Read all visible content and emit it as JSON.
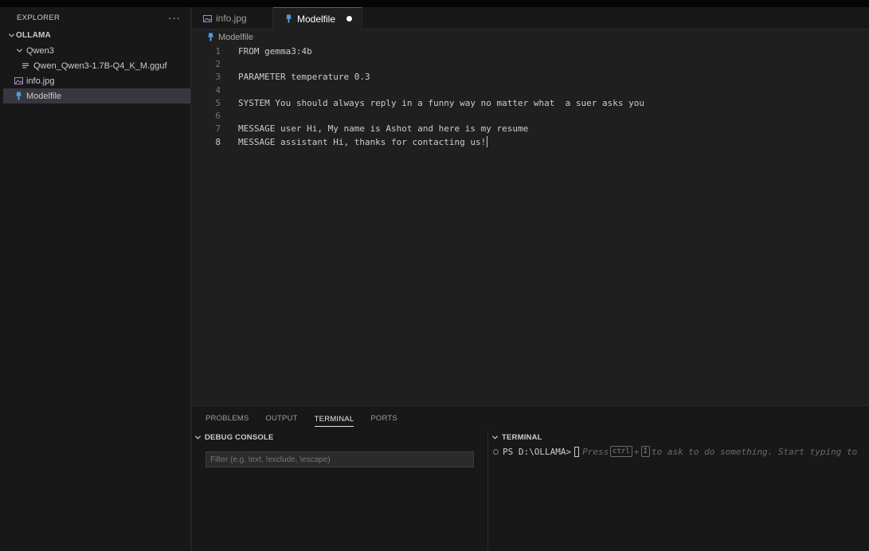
{
  "explorer": {
    "title": "EXPLORER",
    "more": "···",
    "root": "OLLAMA",
    "folder": "Qwen3",
    "gguf_file": "Qwen_Qwen3-1.7B-Q4_K_M.gguf",
    "image_file": "info.jpg",
    "model_file": "Modelfile"
  },
  "tabs": [
    {
      "label": "info.jpg"
    },
    {
      "label": "Modelfile"
    }
  ],
  "breadcrumb": "Modelfile",
  "editor": {
    "lines": [
      {
        "n": "1",
        "text": "FROM gemma3:4b"
      },
      {
        "n": "2",
        "text": ""
      },
      {
        "n": "3",
        "text": "PARAMETER temperature 0.3"
      },
      {
        "n": "4",
        "text": ""
      },
      {
        "n": "5",
        "text": "SYSTEM You should always reply in a funny way no matter what  a suer asks you"
      },
      {
        "n": "6",
        "text": ""
      },
      {
        "n": "7",
        "text": "MESSAGE user Hi, My name is Ashot and here is my resume"
      },
      {
        "n": "8",
        "text": "MESSAGE assistant Hi, thanks for contacting us!"
      }
    ]
  },
  "panel": {
    "tabs": [
      "PROBLEMS",
      "OUTPUT",
      "TERMINAL",
      "PORTS"
    ],
    "debug_console_title": "DEBUG CONSOLE",
    "filter_placeholder": "Filter (e.g. text, !exclude, \\escape)",
    "terminal_title": "TERMINAL",
    "prompt": "PS D:\\OLLAMA>",
    "hint_press": "Press",
    "key_ctrl": "ctrl",
    "key_plus": "+",
    "key_i": "I",
    "hint_rest": "to ask to do something. Start typing to"
  },
  "colors": {
    "accent": "#0078d4",
    "model_icon": "#4e9cdf",
    "image_icon": "#b180d7"
  }
}
